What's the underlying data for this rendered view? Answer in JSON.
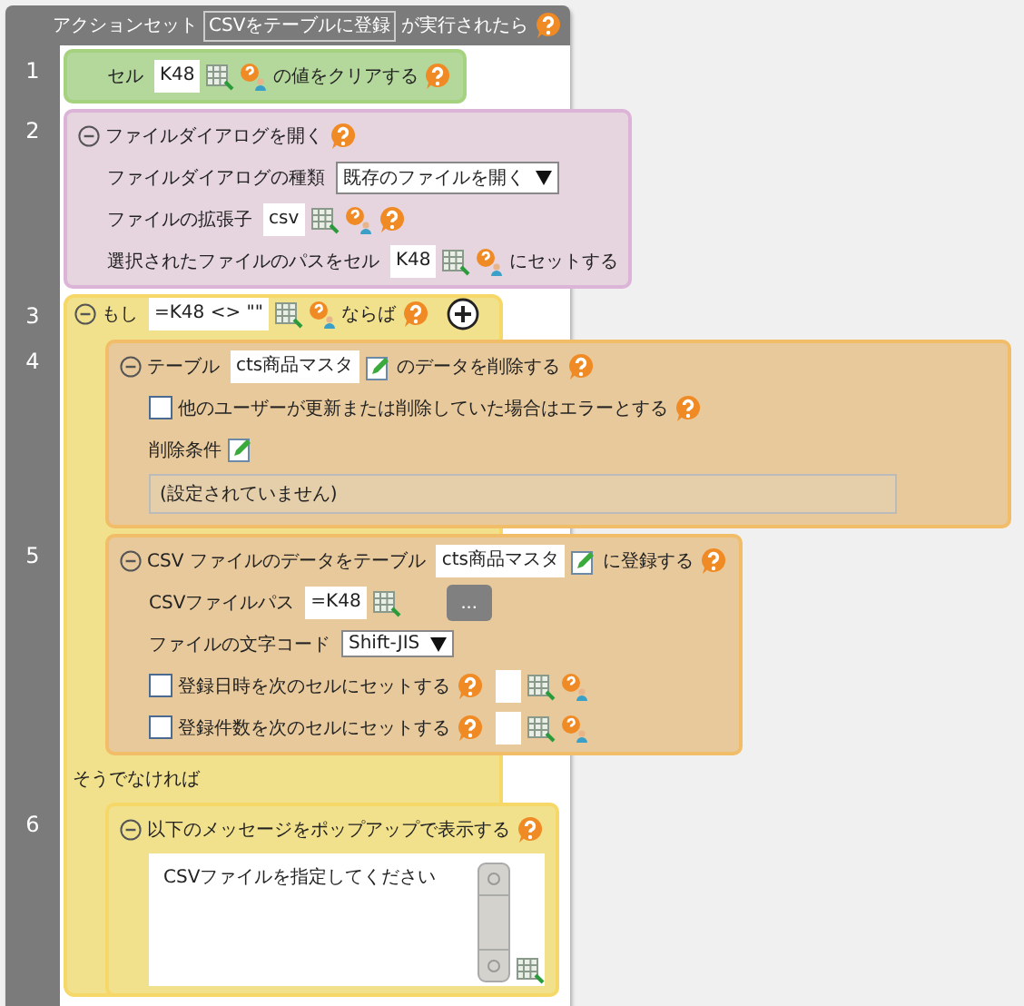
{
  "header": {
    "prefix": "アクションセット",
    "action_set": "CSVをテーブルに登録",
    "suffix": "が実行されたら"
  },
  "steps": [
    {
      "number": "1",
      "kind": "clear",
      "before": "セル",
      "cell": "K48",
      "after": "の値をクリアする"
    },
    {
      "number": "2",
      "kind": "dialog",
      "expanded": true,
      "title": "ファイルダイアログを開く",
      "type_label": "ファイルダイアログの種類",
      "type_value": "既存のファイルを開く",
      "ext_label": "ファイルの拡張子",
      "ext_value": "csv",
      "path_label": "選択されたファイルのパスをセル",
      "path_value": "K48",
      "path_suffix": "にセットする"
    }
  ],
  "if_block": {
    "number": "3",
    "expanded": true,
    "prefix": "もし",
    "condition": "=K48 <> \"\"",
    "suffix": "ならば",
    "then": [
      {
        "number": "4",
        "kind": "delete",
        "expanded": true,
        "before": "テーブル",
        "table": "cts商品マスタ",
        "after": "のデータを削除する",
        "option": {
          "label": "他のユーザーが更新または削除していた場合はエラーとする",
          "checked": false
        },
        "condition_label": "削除条件",
        "condition_value": "(設定されていません)"
      },
      {
        "number": "5",
        "kind": "import",
        "expanded": true,
        "before": "CSV ファイルのデータをテーブル",
        "table": "cts商品マスタ",
        "after": "に登録する",
        "path_label": "CSVファイルパス",
        "path_value": "=K48",
        "browse": "...",
        "encoding_label": "ファイルの文字コード",
        "encoding": "Shift-JIS",
        "options": [
          {
            "label": "登録日時を次のセルにセットする",
            "checked": false
          },
          {
            "label": "登録件数を次のセルにセットする",
            "checked": false
          }
        ]
      }
    ],
    "else_label": "そうでなければ",
    "else": [
      {
        "number": "6",
        "kind": "popup",
        "expanded": true,
        "title": "以下のメッセージをポップアップで表示する",
        "message": "CSVファイルを指定してください"
      }
    ]
  }
}
